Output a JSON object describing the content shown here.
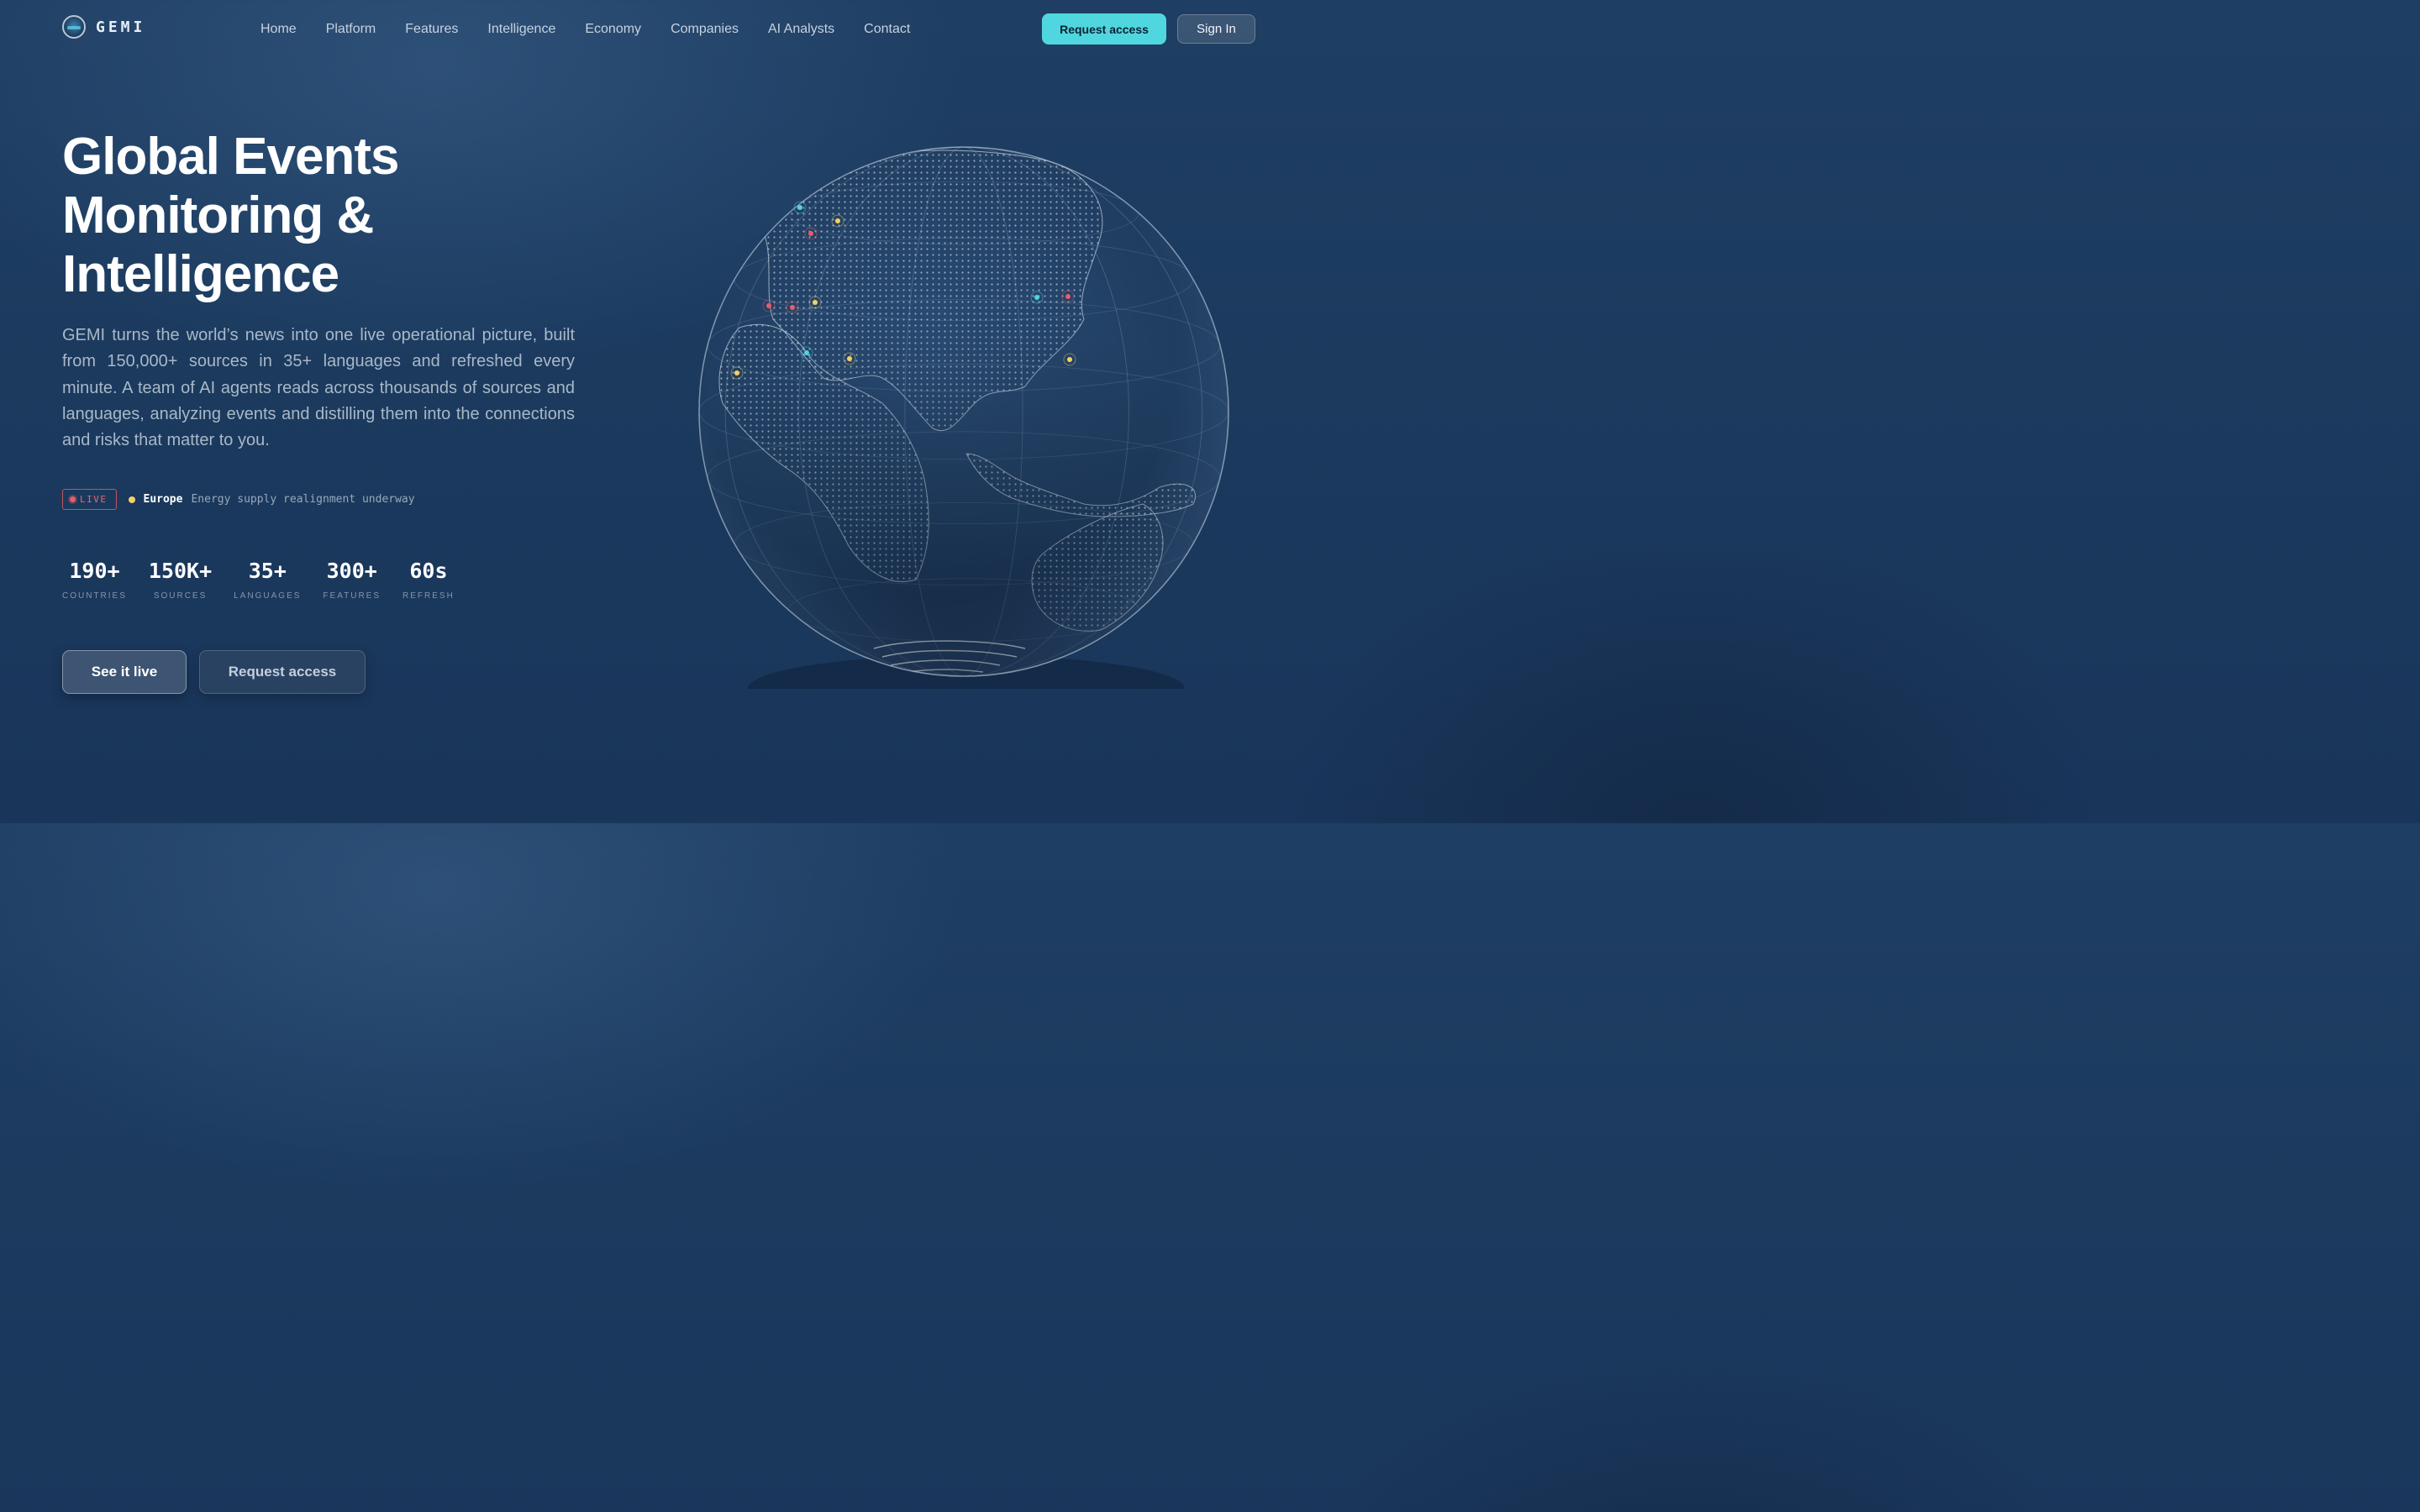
{
  "brand": {
    "name": "GEMI",
    "logo_icon": "globe-logo-icon"
  },
  "nav": {
    "items": [
      "Home",
      "Platform",
      "Features",
      "Intelligence",
      "Economy",
      "Companies",
      "AI Analysts",
      "Contact"
    ]
  },
  "header_actions": {
    "request_access": "Request access",
    "sign_in": "Sign In"
  },
  "hero": {
    "title_lines": [
      "Global Events",
      "Monitoring &",
      "Intelligence"
    ],
    "description": "GEMI turns the world’s news into one live operational picture, built from 150,000+ sources in 35+ languages and refreshed every minute. A team of AI agents reads across thousands of sources and languages, analyzing events and distilling them into the connections and risks that matter to you."
  },
  "ticker": {
    "badge": "LIVE",
    "region": "Europe",
    "headline": "Energy supply realignment underway"
  },
  "stats": [
    {
      "value": "190+",
      "label": "COUNTRIES"
    },
    {
      "value": "150K+",
      "label": "SOURCES"
    },
    {
      "value": "35+",
      "label": "LANGUAGES"
    },
    {
      "value": "300+",
      "label": "FEATURES"
    },
    {
      "value": "60s",
      "label": "REFRESH"
    }
  ],
  "cta": {
    "primary": "See it live",
    "secondary": "Request access"
  },
  "colors": {
    "accent": "#4fd6de",
    "live": "#e85e68",
    "marker_yellow": "#f4d165",
    "marker_cyan": "#4fd6de",
    "marker_red": "#e85e68"
  },
  "globe": {
    "markers": [
      {
        "color": "cyan"
      },
      {
        "color": "yellow"
      },
      {
        "color": "red"
      },
      {
        "color": "red"
      },
      {
        "color": "red"
      },
      {
        "color": "yellow"
      },
      {
        "color": "cyan"
      },
      {
        "color": "yellow"
      },
      {
        "color": "yellow"
      },
      {
        "color": "cyan"
      },
      {
        "color": "red"
      },
      {
        "color": "yellow"
      }
    ]
  }
}
